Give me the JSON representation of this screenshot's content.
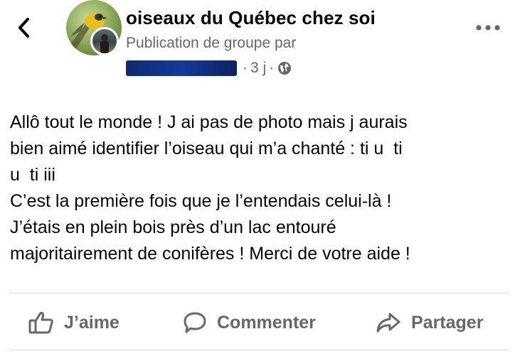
{
  "header": {
    "back_icon": "chevron-left-icon",
    "group_name": "oiseaux du Québec chez soi",
    "subtitle": "Publication de groupe par",
    "author_redacted": true,
    "time_ago": "3 j",
    "separator": "·",
    "privacy_icon": "globe-icon",
    "more_icon": "more-horizontal-icon"
  },
  "post": {
    "lines": [
      "Allô tout le monde ! J ai pas de photo mais j aurais",
      "bien aimé identifier l’oiseau qui m’a chanté : ti u  ti",
      "u  ti iii",
      "C’est la première fois que je l’entendais celui-là !",
      "J’étais en plein bois près d’un lac entouré",
      "majoritairement de conifères ! Merci de votre aide !"
    ]
  },
  "actions": {
    "like": {
      "label": "J’aime",
      "icon": "thumbs-up-icon"
    },
    "comment": {
      "label": "Commenter",
      "icon": "comment-icon"
    },
    "share": {
      "label": "Partager",
      "icon": "share-icon"
    }
  },
  "colors": {
    "text_primary": "#050505",
    "text_secondary": "#65676b",
    "divider": "#dadde1",
    "redaction": "#143a9a"
  }
}
